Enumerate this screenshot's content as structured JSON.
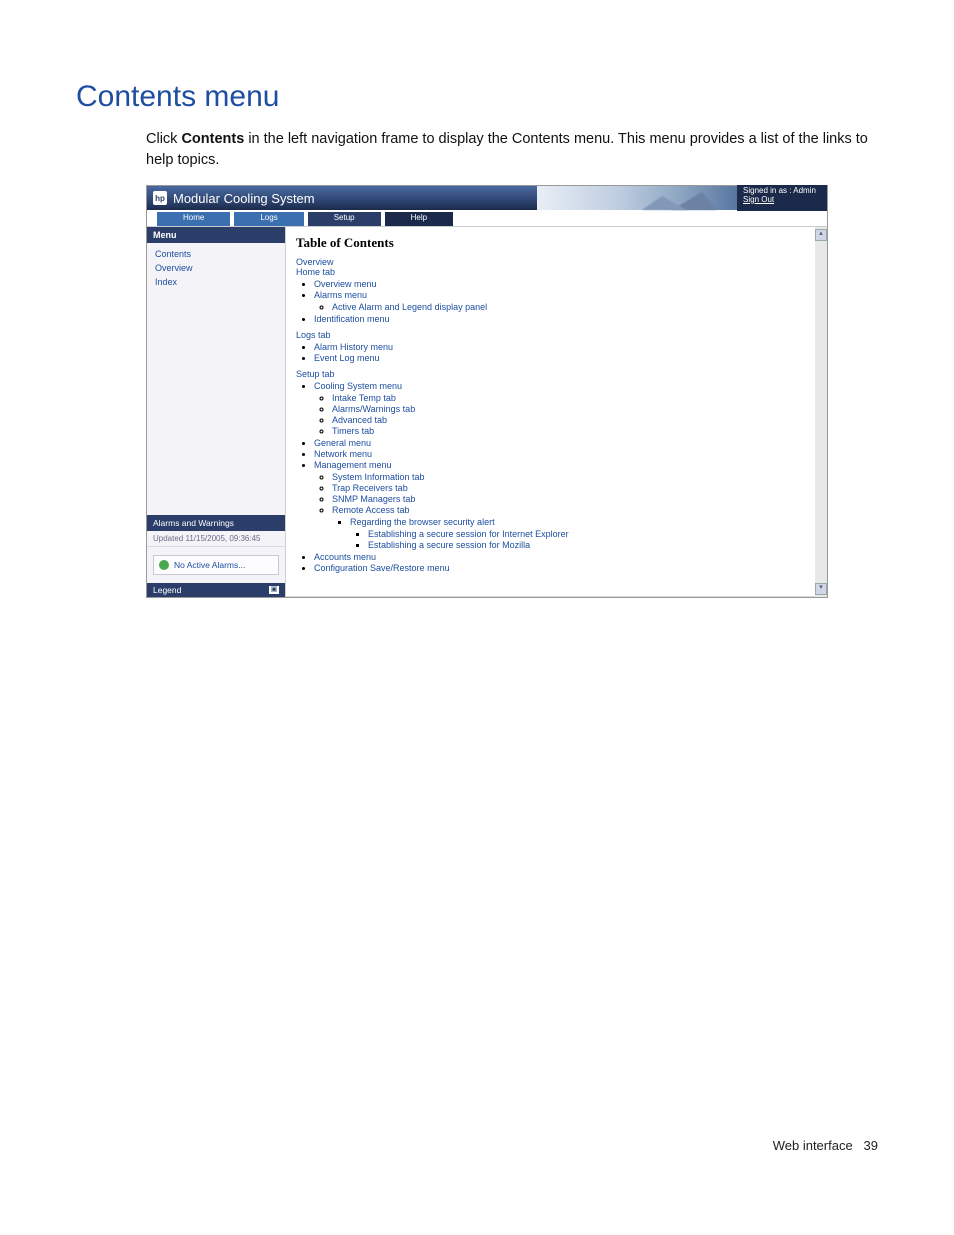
{
  "page": {
    "heading": "Contents menu",
    "intro_a": "Click ",
    "intro_bold": "Contents",
    "intro_b": " in the left navigation frame to display the Contents menu. This menu provides a list of the links to help topics."
  },
  "app": {
    "title": "Modular Cooling System",
    "signed_in": "Signed in as : Admin",
    "sign_out": "Sign Out"
  },
  "tabs": {
    "home": "Home",
    "logs": "Logs",
    "setup": "Setup",
    "help": "Help"
  },
  "left": {
    "menu_title": "Menu",
    "items": {
      "contents": "Contents",
      "overview": "Overview",
      "index": "Index"
    },
    "alarms_title": "Alarms and Warnings",
    "updated": "Updated 11/15/2005, 09:36:45",
    "no_alarms": "No Active Alarms...",
    "legend": "Legend"
  },
  "toc": {
    "heading": "Table of Contents",
    "overview": "Overview",
    "home_tab": "Home tab",
    "overview_menu": "Overview menu",
    "alarms_menu": "Alarms menu",
    "active_alarm_panel": "Active Alarm and Legend display panel",
    "identification_menu": "Identification menu",
    "logs_tab": "Logs tab",
    "alarm_history_menu": "Alarm History menu",
    "event_log_menu": "Event Log menu",
    "setup_tab": "Setup tab",
    "cooling_system_menu": "Cooling System menu",
    "intake_temp_tab": "Intake Temp tab",
    "alarms_warnings_tab": "Alarms/Warnings tab",
    "advanced_tab": "Advanced tab",
    "timers_tab": "Timers tab",
    "general_menu": "General menu",
    "network_menu": "Network menu",
    "management_menu": "Management menu",
    "system_info_tab": "System Information tab",
    "trap_receivers_tab": "Trap Receivers tab",
    "snmp_managers_tab": "SNMP Managers tab",
    "remote_access_tab": "Remote Access tab",
    "regarding_alert": "Regarding the browser security alert",
    "establish_ie": "Establishing a secure session for Internet Explorer",
    "establish_moz": "Establishing a secure session for Mozilla",
    "accounts_menu": "Accounts menu",
    "config_save_restore": "Configuration Save/Restore menu"
  },
  "footer": {
    "label": "Web interface",
    "page_no": "39"
  }
}
